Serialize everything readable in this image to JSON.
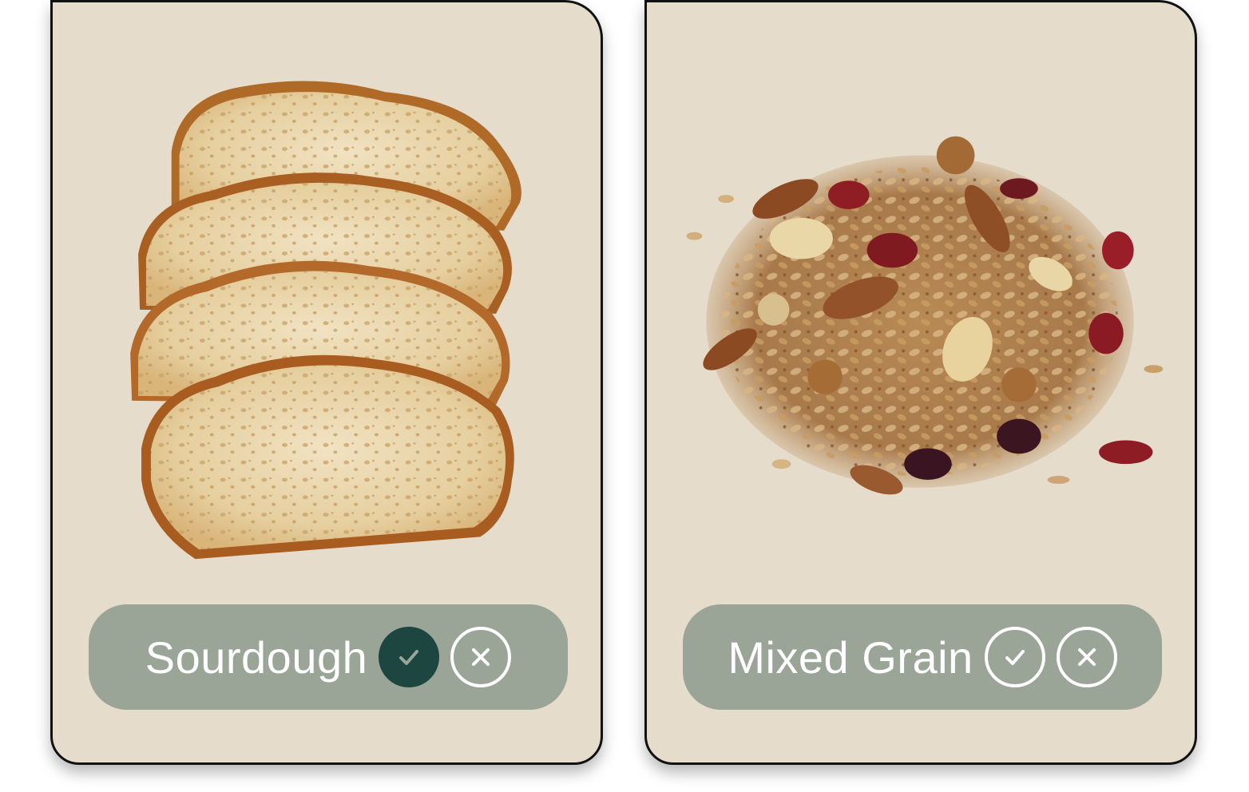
{
  "cards": [
    {
      "label": "Sourdough",
      "image_alt": "sourdough bread slices",
      "accept_selected": true,
      "accept_icon": "check-icon",
      "reject_icon": "close-icon"
    },
    {
      "label": "Mixed Grain",
      "image_alt": "granola mix with nuts and dried fruit",
      "accept_selected": false,
      "accept_icon": "check-icon",
      "reject_icon": "close-icon"
    }
  ],
  "colors": {
    "card_background": "#e5dccb",
    "pill_background": "#9aa497",
    "selected_accent": "#1e4640",
    "text": "#ffffff"
  }
}
